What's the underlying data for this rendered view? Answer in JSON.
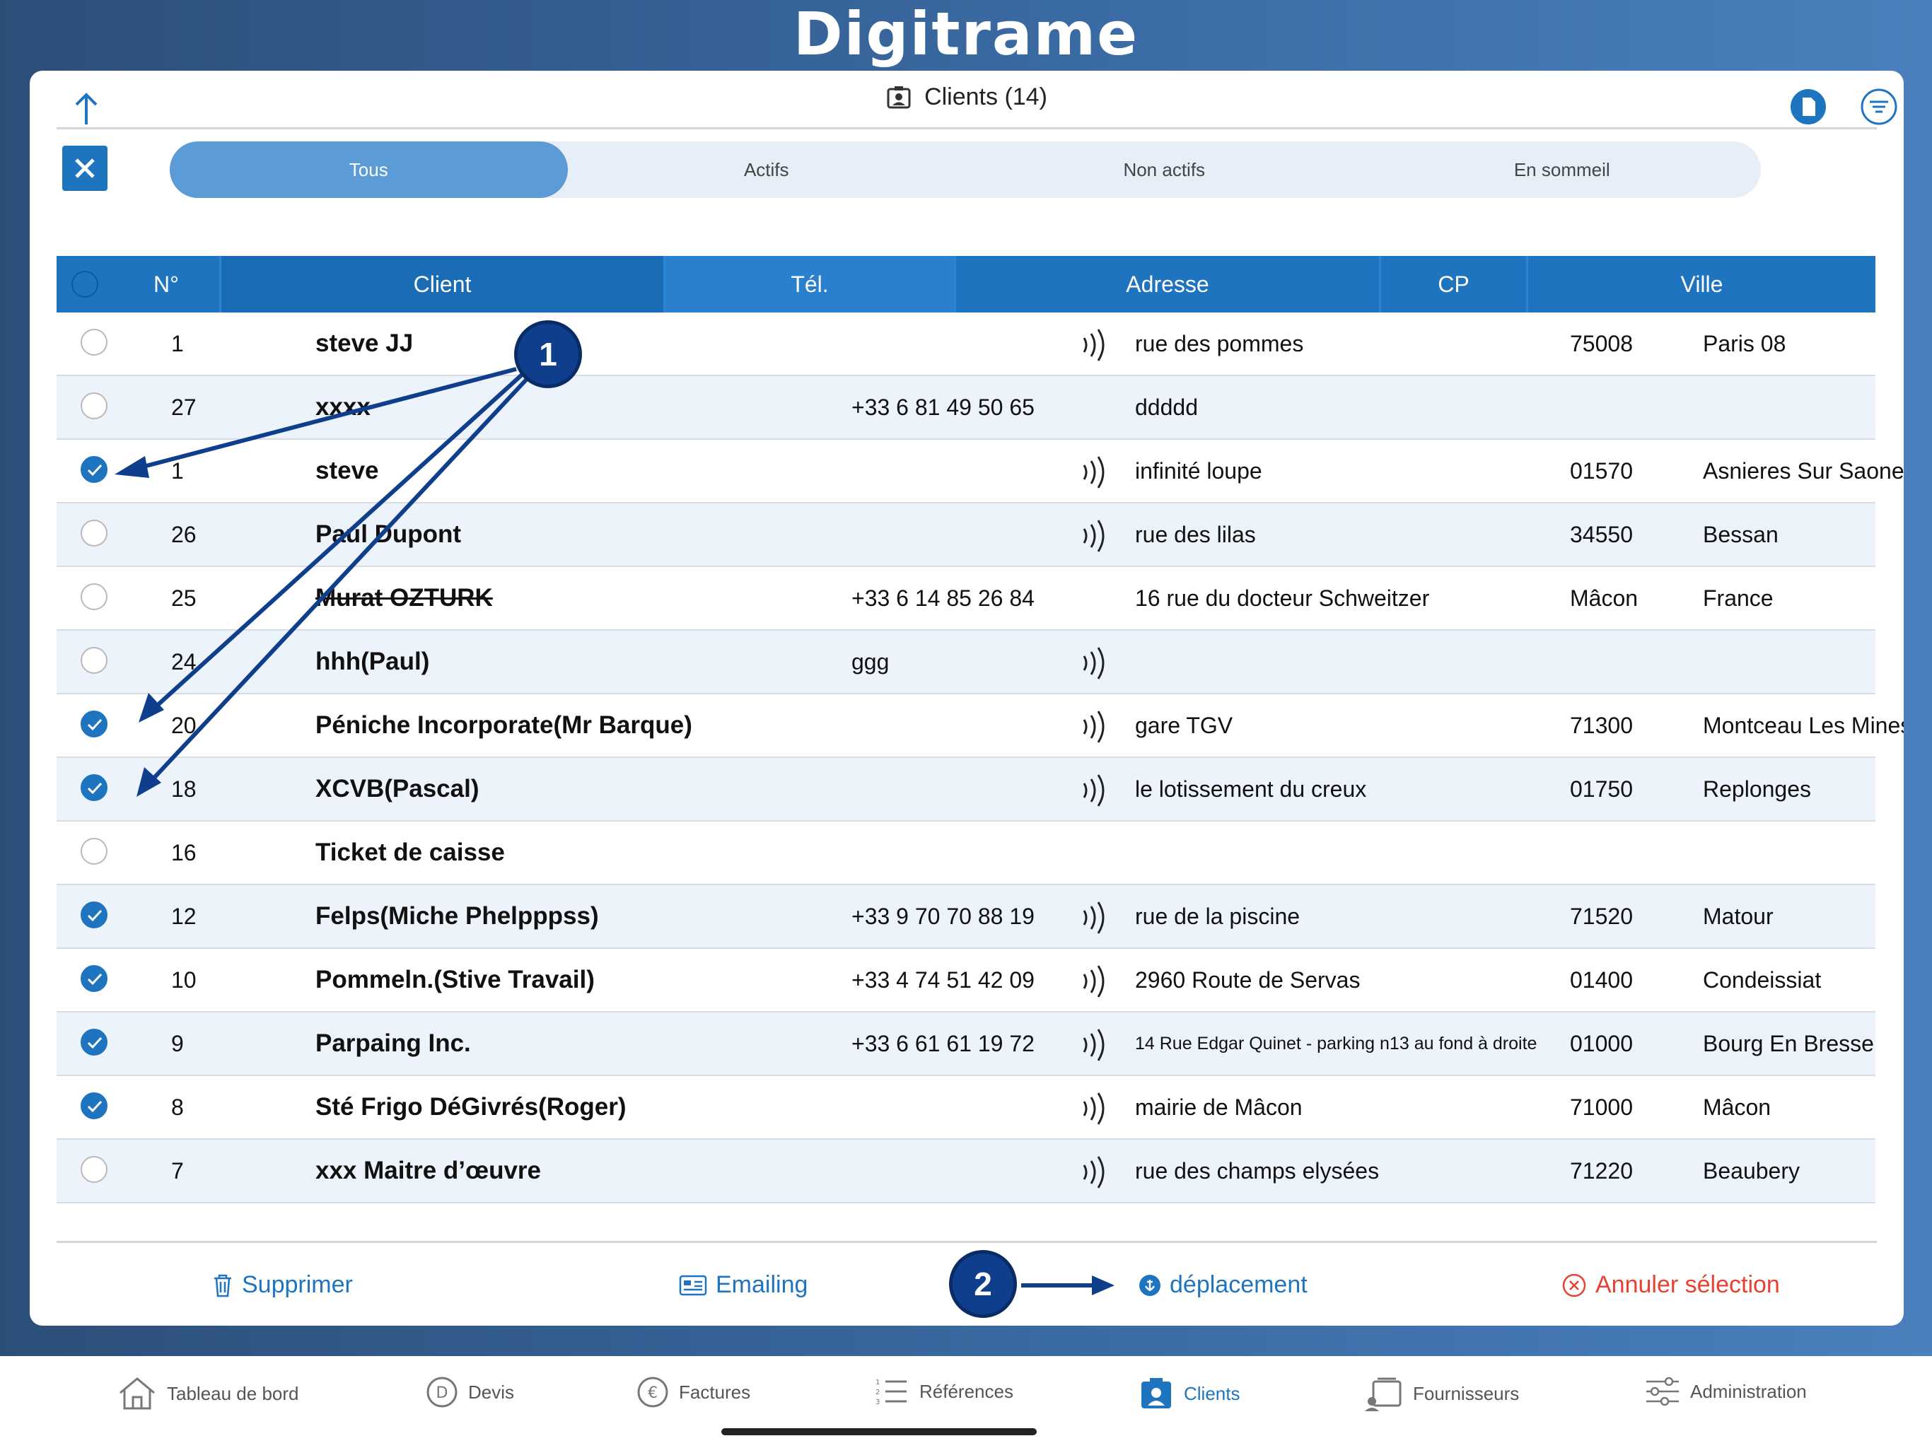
{
  "app": {
    "logo": "Digitrame"
  },
  "header": {
    "title": "Clients (14)"
  },
  "segments": [
    {
      "label": "Tous",
      "active": true
    },
    {
      "label": "Actifs",
      "active": false
    },
    {
      "label": "Non actifs",
      "active": false
    },
    {
      "label": "En sommeil",
      "active": false
    }
  ],
  "table": {
    "columns": {
      "num": "N°",
      "client": "Client",
      "tel": "Tél.",
      "addr": "Adresse",
      "cp": "CP",
      "ville": "Ville"
    },
    "rows": [
      {
        "checked": false,
        "num": "1",
        "client": "steve JJ",
        "tel": "",
        "nfc": true,
        "addr": "rue des pommes",
        "cp": "75008",
        "ville": "Paris 08"
      },
      {
        "checked": false,
        "num": "27",
        "client": "xxxx",
        "tel": "+33 6 81 49 50 65",
        "nfc": false,
        "addr": "ddddd",
        "cp": "",
        "ville": ""
      },
      {
        "checked": true,
        "num": "1",
        "client": "steve",
        "tel": "",
        "nfc": true,
        "addr": "infinité loupe",
        "cp": "01570",
        "ville": "Asnieres Sur Saone"
      },
      {
        "checked": false,
        "num": "26",
        "client": "Paul Dupont",
        "tel": "",
        "nfc": true,
        "addr": "rue des lilas",
        "cp": "34550",
        "ville": "Bessan"
      },
      {
        "checked": false,
        "num": "25",
        "client": "Murat OZTURK",
        "strike": true,
        "tel": "+33 6 14 85 26 84",
        "nfc": false,
        "addr": "16 rue du docteur Schweitzer",
        "cp": "Mâcon",
        "ville": "France"
      },
      {
        "checked": false,
        "num": "24",
        "client": "hhh(Paul)",
        "tel": "ggg",
        "nfc": true,
        "addr": "",
        "cp": "",
        "ville": ""
      },
      {
        "checked": true,
        "num": "20",
        "client": "Péniche Incorporate(Mr Barque)",
        "tel": "",
        "nfc": true,
        "addr": "gare TGV",
        "cp": "71300",
        "ville": "Montceau Les Mines"
      },
      {
        "checked": true,
        "num": "18",
        "client": "XCVB(Pascal)",
        "tel": "",
        "nfc": true,
        "addr": "le lotissement du creux",
        "cp": "01750",
        "ville": "Replonges"
      },
      {
        "checked": false,
        "num": "16",
        "client": "Ticket de caisse",
        "tel": "",
        "nfc": false,
        "addr": "",
        "cp": "",
        "ville": ""
      },
      {
        "checked": true,
        "num": "12",
        "client": "Felps(Miche Phelpppss)",
        "tel": "+33 9 70 70 88 19",
        "nfc": true,
        "addr": "rue de la piscine",
        "cp": "71520",
        "ville": "Matour"
      },
      {
        "checked": true,
        "num": "10",
        "client": "Pommeln.(Stive Travail)",
        "tel": "+33 4 74 51 42 09",
        "nfc": true,
        "addr": "2960 Route de Servas",
        "cp": "01400",
        "ville": "Condeissiat"
      },
      {
        "checked": true,
        "num": "9",
        "client": "Parpaing Inc.",
        "tel": "+33 6 61 61 19 72",
        "nfc": true,
        "addr": "14 Rue Edgar Quinet - parking n13 au fond à droite",
        "small": true,
        "cp": "01000",
        "ville": "Bourg En Bresse"
      },
      {
        "checked": true,
        "num": "8",
        "client": "Sté Frigo DéGivrés(Roger)",
        "tel": "",
        "nfc": true,
        "addr": "mairie de Mâcon",
        "cp": "71000",
        "ville": "Mâcon"
      },
      {
        "checked": false,
        "num": "7",
        "client": "xxx Maitre d’œuvre",
        "tel": "",
        "nfc": true,
        "addr": "rue des champs elysées",
        "cp": "71220",
        "ville": "Beaubery"
      }
    ]
  },
  "actions": {
    "delete": "Supprimer",
    "emailing": "Emailing",
    "move": "déplacement",
    "cancel": "Annuler sélection"
  },
  "annotations": {
    "badge1": "1",
    "badge2": "2"
  },
  "tabbar": [
    {
      "label": "Tableau de bord",
      "icon": "home-icon"
    },
    {
      "label": "Devis",
      "icon": "devis-icon"
    },
    {
      "label": "Factures",
      "icon": "euro-icon"
    },
    {
      "label": "Références",
      "icon": "list-icon"
    },
    {
      "label": "Clients",
      "icon": "clients-icon",
      "active": true
    },
    {
      "label": "Fournisseurs",
      "icon": "supplier-icon"
    },
    {
      "label": "Administration",
      "icon": "sliders-icon"
    }
  ],
  "colors": {
    "accent": "#1f74c0",
    "danger": "#e8412f",
    "badge": "#0f3f8c"
  }
}
